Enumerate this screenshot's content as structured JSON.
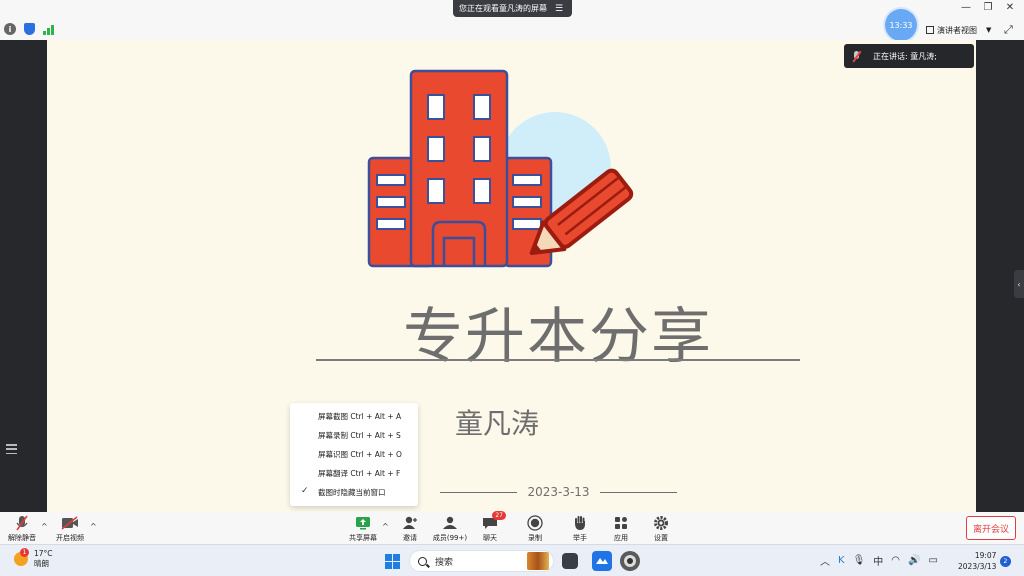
{
  "window": {
    "share_banner": "您正在观看童凡涛的屏幕",
    "clock": "13:33",
    "view_mode": "演讲者视图",
    "speaking": "正在讲话: 童凡涛;"
  },
  "slide": {
    "title": "专升本分享",
    "presenter": "童凡涛",
    "date": "2023-3-13"
  },
  "context_menu": [
    {
      "label": "屏幕截图 Ctrl + Alt + A",
      "checked": false
    },
    {
      "label": "屏幕录制 Ctrl + Alt + S",
      "checked": false
    },
    {
      "label": "屏幕识图 Ctrl + Alt + O",
      "checked": false
    },
    {
      "label": "屏幕翻译 Ctrl + Alt + F",
      "checked": false
    },
    {
      "label": "截图时隐藏当前窗口",
      "checked": true
    }
  ],
  "controls": {
    "unmute": "解除静音",
    "start_video": "开启视频",
    "share_screen": "共享屏幕",
    "invite": "邀请",
    "members": "成员(99+)",
    "chat": "聊天",
    "chat_badge": "27",
    "record": "录制",
    "raise_hand": "举手",
    "apps": "应用",
    "settings": "设置",
    "leave": "离开会议"
  },
  "taskbar": {
    "temp": "17°C",
    "weather": "晴朗",
    "weather_badge": "1",
    "search": "搜索",
    "ime": "中",
    "time": "19:07",
    "date": "2023/3/13",
    "notifications": "2"
  },
  "colors": {
    "building_red": "#e8492f",
    "building_outline": "#3b4f9a",
    "pencil_dark": "#9c1c10",
    "sky_circle": "#cfeefa",
    "slide_bg": "#fdf9ea",
    "leave_red": "#e23c3c"
  }
}
